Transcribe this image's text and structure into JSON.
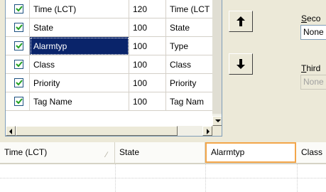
{
  "columns_list": {
    "rows": [
      {
        "checked": true,
        "name": "Time (LCT)",
        "width": "120",
        "title": "Time (LCT"
      },
      {
        "checked": true,
        "name": "State",
        "width": "100",
        "title": "State"
      },
      {
        "checked": true,
        "name": "Alarmtyp",
        "width": "100",
        "title": "Type",
        "selected": true
      },
      {
        "checked": true,
        "name": "Class",
        "width": "100",
        "title": "Class"
      },
      {
        "checked": true,
        "name": "Priority",
        "width": "100",
        "title": "Priority"
      },
      {
        "checked": true,
        "name": "Tag Name",
        "width": "100",
        "title": "Tag Nam"
      }
    ]
  },
  "move_buttons": {
    "up_icon": "arrow-up-icon",
    "down_icon": "arrow-down-icon"
  },
  "sort": {
    "second_label_u": "S",
    "second_label_rest": "eco",
    "second_value": "None",
    "third_label_u": "T",
    "third_label_rest": "hird",
    "third_value": "None"
  },
  "preview_grid": {
    "headers": [
      {
        "label": "Time (LCT)",
        "sorted": true
      },
      {
        "label": "State"
      },
      {
        "label": "Alarmtyp",
        "active": true
      },
      {
        "label": "Class"
      }
    ]
  },
  "colors": {
    "selection": "#0a246a",
    "active_header_border": "#f3a64a",
    "checkbox_border": "#1c5180"
  }
}
